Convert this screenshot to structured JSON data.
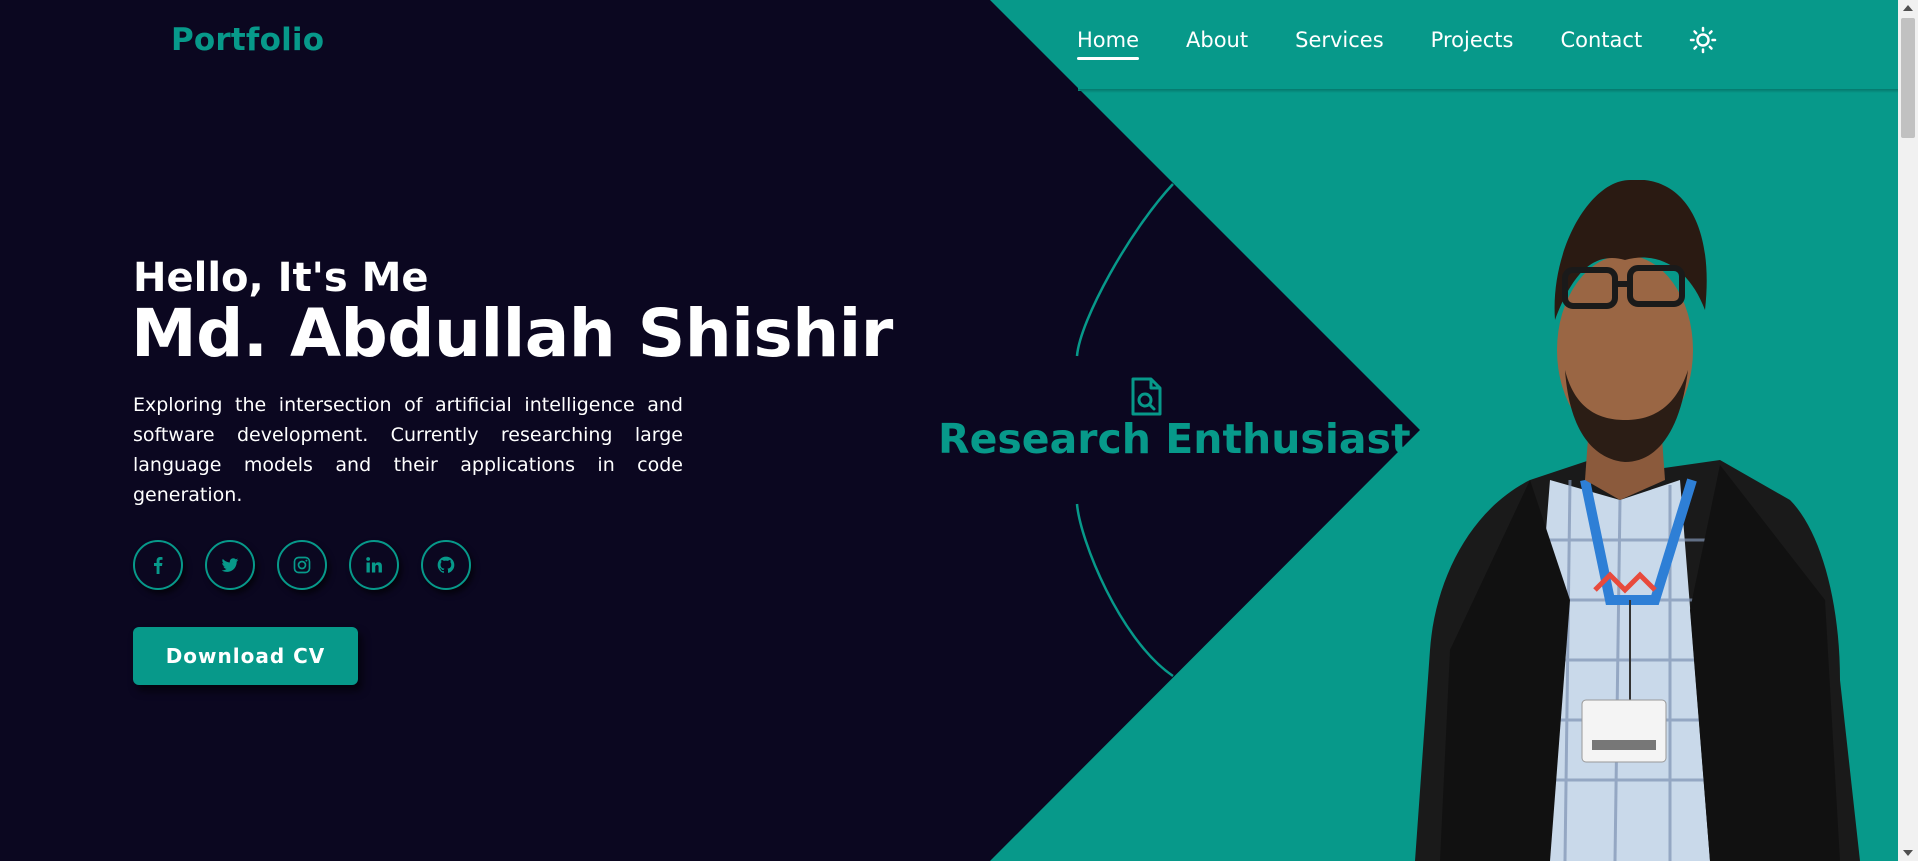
{
  "header": {
    "logo": "Portfolio",
    "nav": [
      {
        "label": "Home",
        "active": true
      },
      {
        "label": "About",
        "active": false
      },
      {
        "label": "Services",
        "active": false
      },
      {
        "label": "Projects",
        "active": false
      },
      {
        "label": "Contact",
        "active": false
      }
    ],
    "theme_toggle_icon": "sun-icon"
  },
  "hero": {
    "greeting": "Hello, It's Me",
    "name": "Md. Abdullah Shishir",
    "bio": "Exploring the intersection of artificial intelligence and software development. Currently researching large language models and their applications in code generation.",
    "socials": [
      {
        "icon": "facebook-icon"
      },
      {
        "icon": "twitter-icon"
      },
      {
        "icon": "instagram-icon"
      },
      {
        "icon": "linkedin-icon"
      },
      {
        "icon": "github-icon"
      }
    ],
    "cv_button": "Download CV"
  },
  "badge": {
    "icon": "document-search-icon",
    "text": "Research Enthusiast"
  },
  "portrait": {
    "icon": "profile-photo"
  },
  "colors": {
    "background": "#0b0720",
    "accent": "#07998a",
    "text": "#ffffff"
  }
}
